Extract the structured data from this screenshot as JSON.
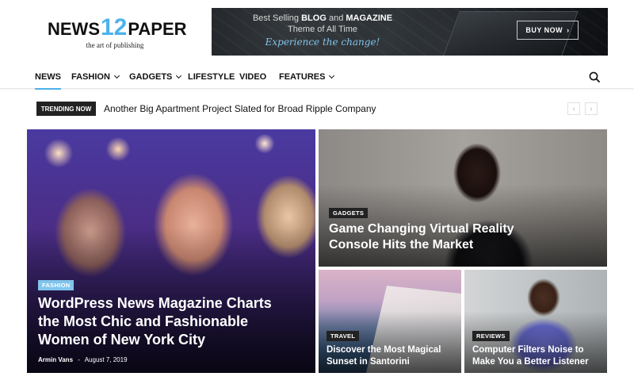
{
  "logo": {
    "word1": "NEWS",
    "number": "12",
    "word2": "PAPER",
    "tagline": "the art of publishing"
  },
  "banner": {
    "line1": "Best Selling",
    "line1_bold": "BLOG",
    "line1_and": "and",
    "line1_bold2": "MAGAZINE",
    "line2": "Theme of All Time",
    "cta": "Experience the change!",
    "button": "BUY NOW"
  },
  "nav": {
    "items": [
      {
        "label": "NEWS",
        "dropdown": false,
        "active": true
      },
      {
        "label": "FASHION",
        "dropdown": true,
        "active": false
      },
      {
        "label": "GADGETS",
        "dropdown": true,
        "active": false
      },
      {
        "label": "LIFESTYLE",
        "dropdown": false,
        "active": false
      },
      {
        "label": "VIDEO",
        "dropdown": false,
        "active": false
      },
      {
        "label": "FEATURES",
        "dropdown": true,
        "active": false
      }
    ],
    "search_icon": "search-icon"
  },
  "trending": {
    "label": "TRENDING NOW",
    "title": "Another Big Apartment Project Slated for Broad Ripple Company",
    "prev": "‹",
    "next": "›"
  },
  "featured": [
    {
      "category": "FASHION",
      "title": "WordPress News Magazine Charts the Most Chic and Fashionable Women of New York City",
      "author": "Armin Vans",
      "separator": "-",
      "date": "August 7, 2019",
      "category_color": "#81c4ec"
    },
    {
      "category": "GADGETS",
      "title": "Game Changing Virtual Reality Console Hits the Market",
      "category_color": "#222222"
    },
    {
      "category": "TRAVEL",
      "title": "Discover the Most Magical Sunset in Santorini",
      "category_color": "#222222"
    },
    {
      "category": "REVIEWS",
      "title": "Computer Filters Noise to Make You a Better Listener",
      "category_color": "#222222"
    }
  ],
  "colors": {
    "accent": "#4db2ec",
    "dark": "#222222"
  }
}
